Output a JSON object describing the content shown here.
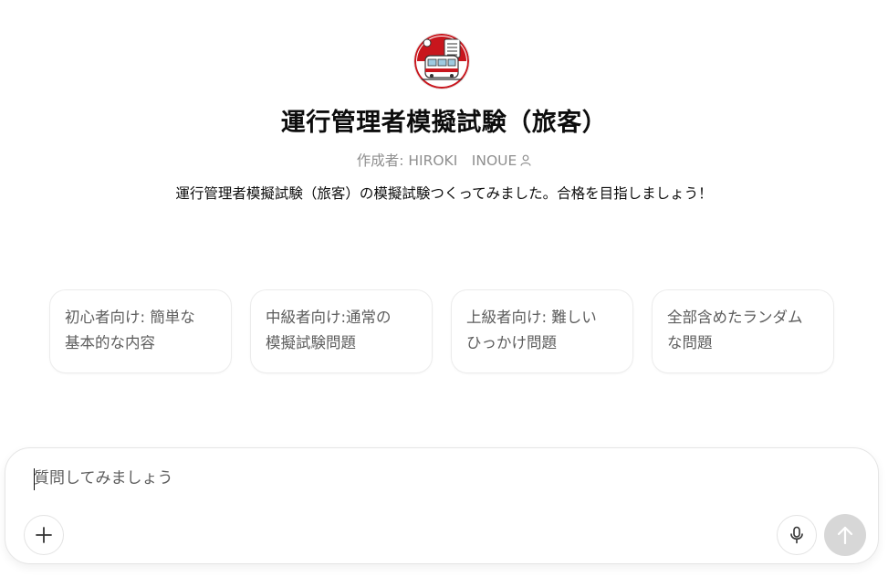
{
  "gpt": {
    "avatar_icon": "train-checklist-logo",
    "title": "運行管理者模擬試験（旅客）",
    "author": "作成者: HIROKI　INOUE",
    "author_icon": "person-icon",
    "description": "運行管理者模擬試験（旅客）の模擬試験つくってみました。合格を目指しましょう！"
  },
  "starters": [
    {
      "label": "初心者向け: 簡単な基本的な内容"
    },
    {
      "label": "中級者向け:通常の模擬試験問題"
    },
    {
      "label": "上級者向け: 難しいひっかけ問題"
    },
    {
      "label": "全部含めたランダムな問題"
    }
  ],
  "composer": {
    "placeholder": "質問してみましょう",
    "value": "",
    "plus_icon": "plus-icon",
    "mic_icon": "microphone-icon",
    "send_icon": "arrow-up-icon"
  },
  "colors": {
    "avatar_red": "#c8161d",
    "text_primary": "#0d0d0d",
    "text_muted": "#8f8f8f",
    "card_border": "#ececec",
    "send_disabled": "#d7d7d7"
  }
}
